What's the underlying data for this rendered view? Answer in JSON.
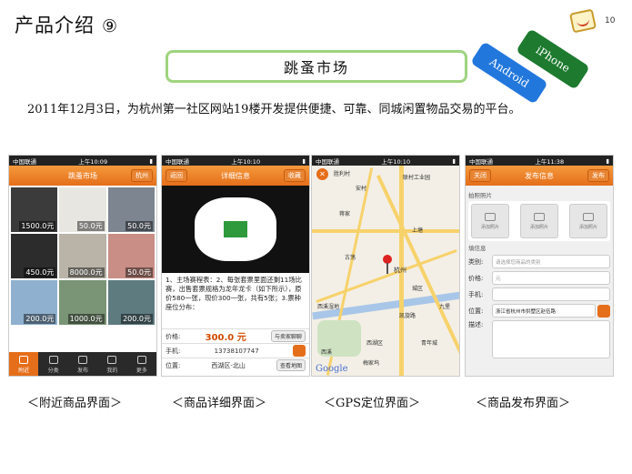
{
  "slide": {
    "title": "产品介绍",
    "number": "⑨",
    "page_no": "10",
    "heading": "跳蚤市场",
    "tags": [
      "iPhone",
      "Android"
    ],
    "description": "2011年12月3日，为杭州第一社区网站19楼开发提供便捷、可靠、同城闲置物品交易的平台。"
  },
  "phones": {
    "p1": {
      "carrier": "中国联通",
      "time": "上午10:09",
      "nav_title": "跳蚤市场",
      "nav_right": "杭州",
      "prices": [
        "1500.0元",
        "50.0元",
        "50.0元",
        "450.0元",
        "8000.0元",
        "50.0元",
        "200.0元",
        "1000.0元",
        "200.0元"
      ],
      "tabs": [
        "附近",
        "分类",
        "发布",
        "我的",
        "更多"
      ]
    },
    "p2": {
      "carrier": "中国联通",
      "time": "上午10:10",
      "nav_left": "返回",
      "nav_title": "详细信息",
      "nav_right": "收藏",
      "text": "1、主场赛程表：2、每张套票里面还剩11场比赛，出售套票规格为龙年龙卡（如下所示），原价580一张，现价300一张，共有5张；3.票种座位分布：",
      "price_label": "价格:",
      "price": "300.0 元",
      "chat_btn": "与卖家聊聊",
      "phone_label": "手机:",
      "phone": "13738107747",
      "loc_label": "位置:",
      "loc": "西湖区-北山",
      "map_btn": "查看地图"
    },
    "p3": {
      "carrier": "中国联通",
      "time": "上午10:10",
      "labels": [
        "胜利村",
        "安村",
        "联村工业园",
        "蒋家",
        "上塘",
        "古荡",
        "杭州",
        "西溪湿地",
        "西溪",
        "城区",
        "九堡",
        "凯旋路",
        "西湖区",
        "青年城",
        "梅家坞"
      ],
      "google": "Google"
    },
    "p4": {
      "carrier": "中国联通",
      "time": "上午11:38",
      "nav_left": "关闭",
      "nav_title": "发布信息",
      "nav_right": "发布",
      "photo_section": "拍照照片",
      "add_photo": "添加照片",
      "info_section": "填信息",
      "fields": [
        {
          "label": "类别:",
          "value": "请选择您商品的类别"
        },
        {
          "label": "价格:",
          "value": "元"
        },
        {
          "label": "手机:",
          "value": ""
        },
        {
          "label": "位置:",
          "value": "浙江省杭州市拱墅区赵伍路"
        },
        {
          "label": "描述:",
          "value": ""
        }
      ]
    }
  },
  "captions": [
    "＜附近商品界面＞",
    "＜商品详细界面＞",
    "＜GPS定位界面＞",
    "＜商品发布界面＞"
  ],
  "colors": {
    "accent": "#e56e1a",
    "heading_border": "#9fd47f",
    "iphone_tag": "#1d7a2f",
    "android_tag": "#2277dd"
  }
}
